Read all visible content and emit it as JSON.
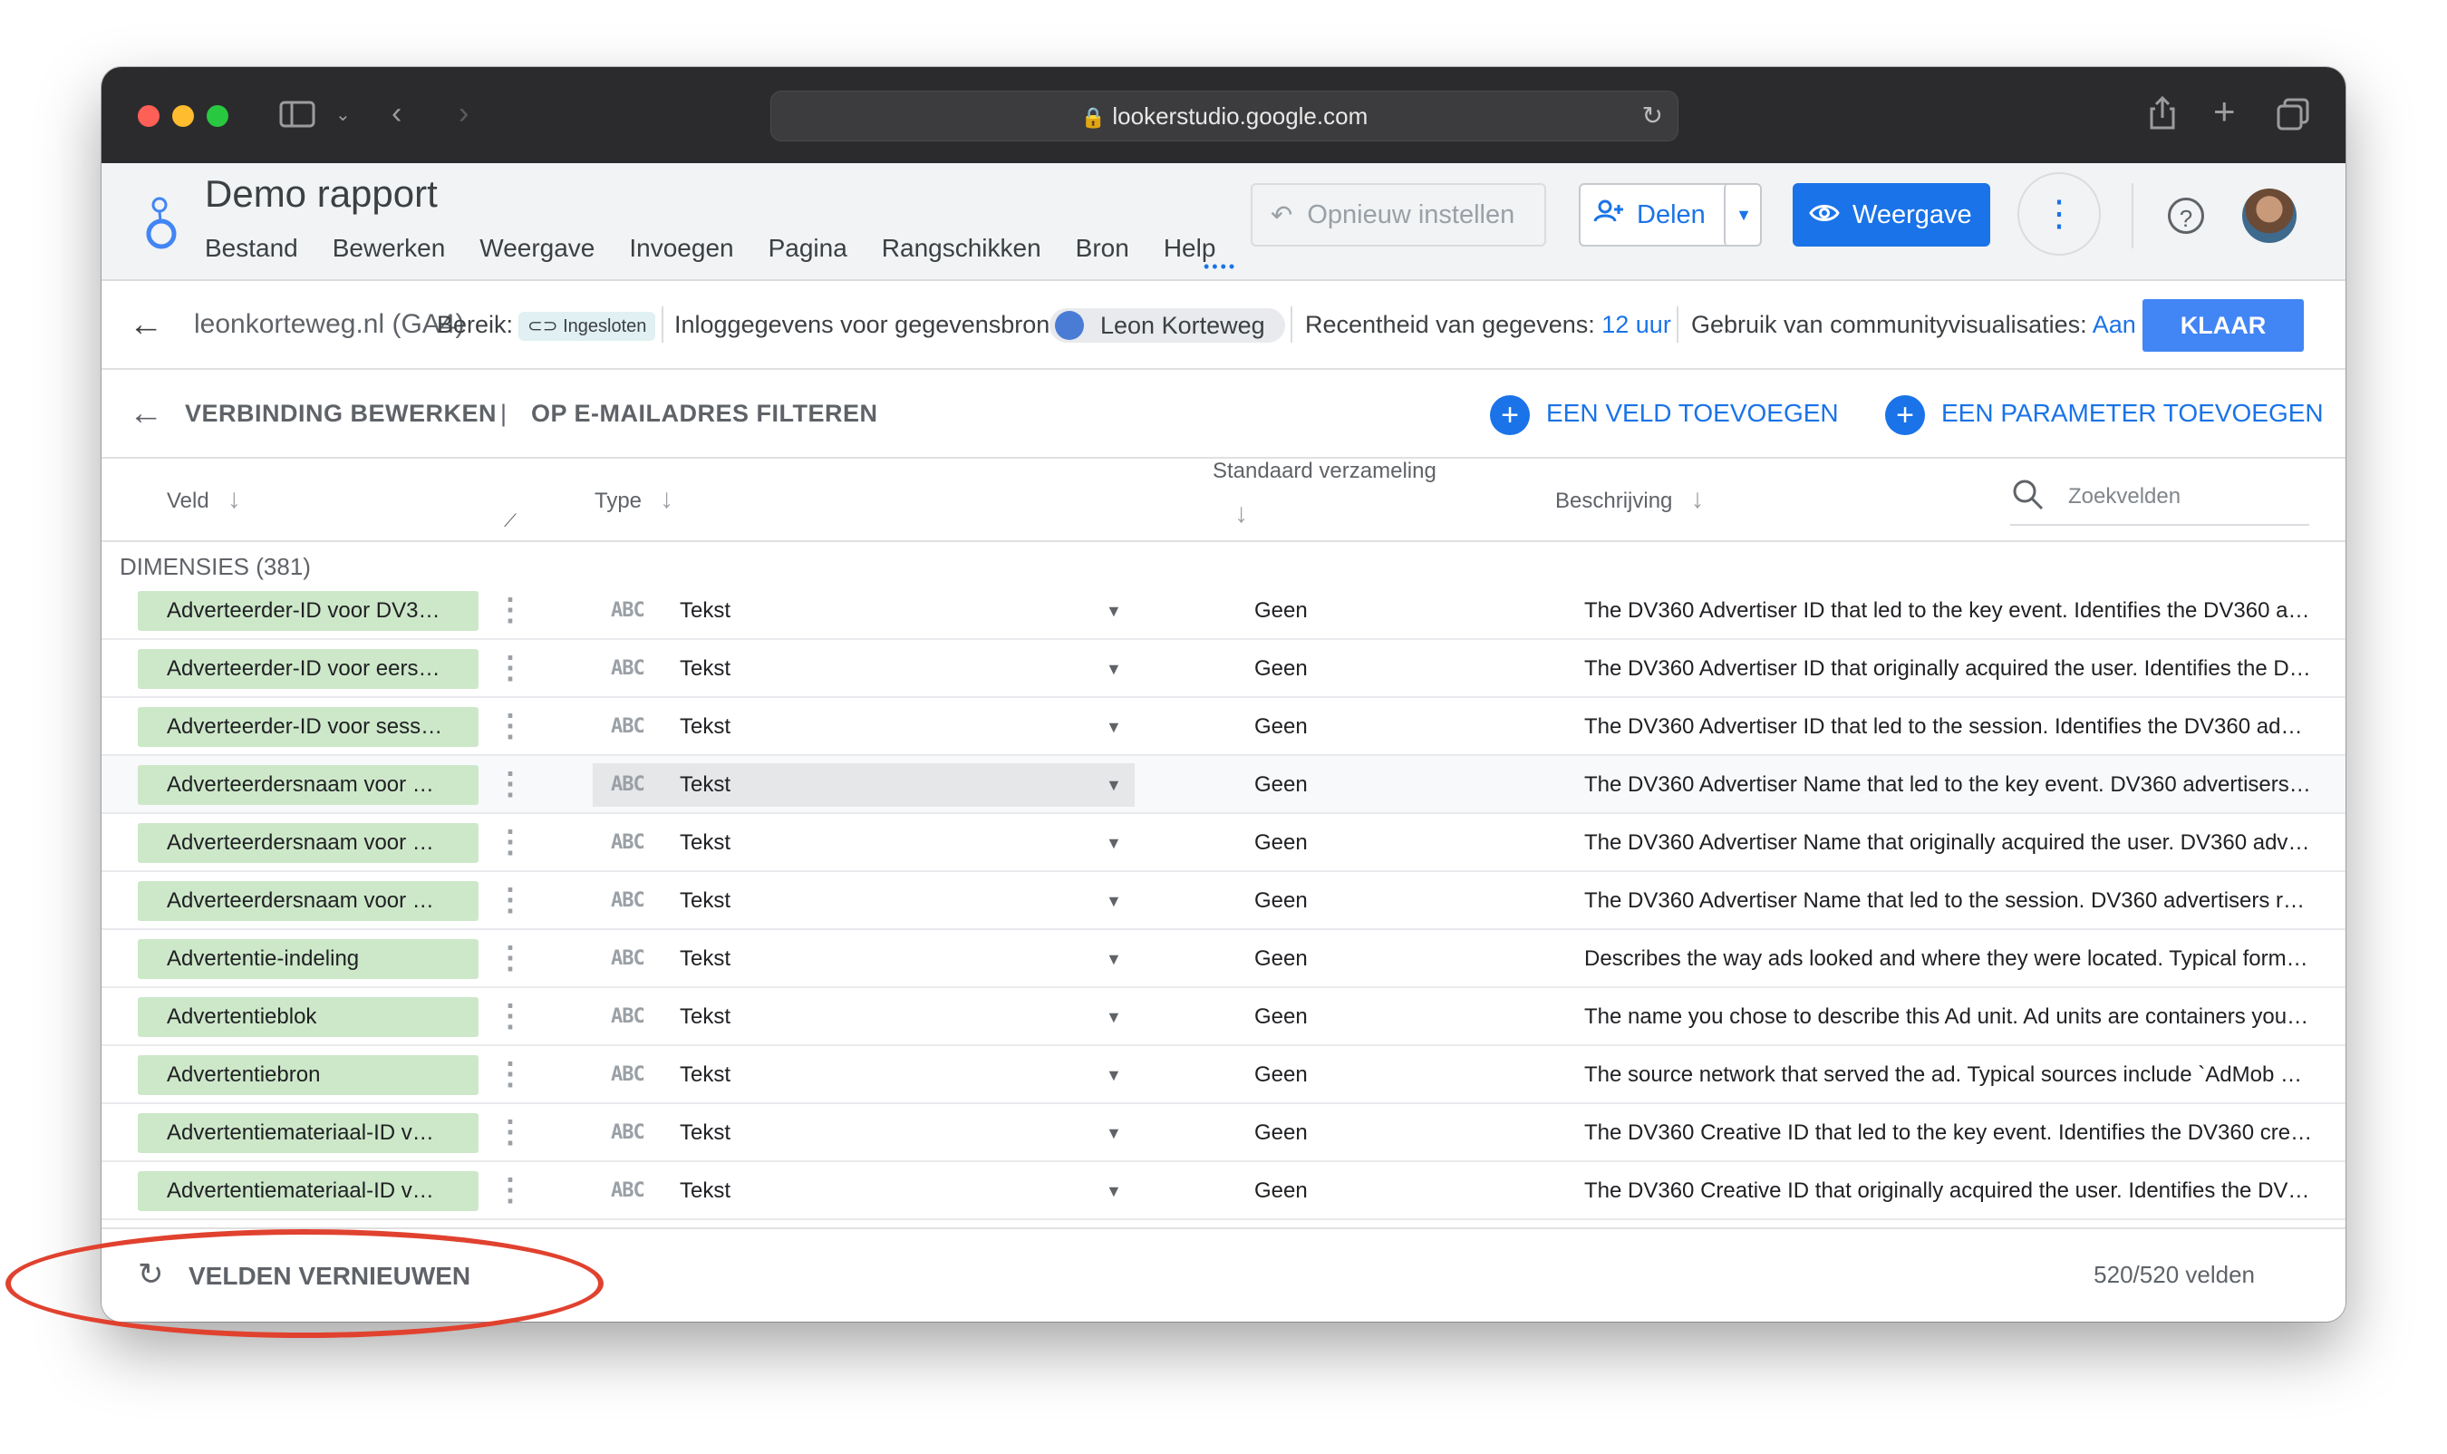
{
  "browser": {
    "url": "lookerstudio.google.com"
  },
  "header": {
    "title": "Demo rapport",
    "menu": [
      "Bestand",
      "Bewerken",
      "Weergave",
      "Invoegen",
      "Pagina",
      "Rangschikken",
      "Bron",
      "Help"
    ],
    "reset_label": "Opnieuw instellen",
    "share_label": "Delen",
    "view_label": "Weergave"
  },
  "datasource": {
    "name": "leonkorteweg.nl (GA4)",
    "scope_label": "Bereik:",
    "scope_value": "Ingesloten",
    "credentials_label": "Inloggegevens voor gegevensbron:",
    "credentials_user": "Leon Korteweg",
    "freshness_label": "Recentheid van gegevens:",
    "freshness_value": "12 uur",
    "community_label": "Gebruik van communityvisualisaties:",
    "community_value": "Aan",
    "done_label": "KLAAR"
  },
  "editor": {
    "edit_connection": "VERBINDING BEWERKEN",
    "divider": "|",
    "filter_email": "OP E-MAILADRES FILTEREN",
    "add_field": "EEN VELD TOEVOEGEN",
    "add_parameter": "EEN PARAMETER TOEVOEGEN"
  },
  "columns": {
    "field": "Veld",
    "type": "Type",
    "aggregation": "Standaard verzameling",
    "description": "Beschrijving",
    "search_placeholder": "Zoekvelden"
  },
  "section_label": "DIMENSIES (381)",
  "rows": [
    {
      "field": "Adverteerder-ID voor DV3…",
      "type_icon": "ABC",
      "type": "Tekst",
      "agg": "Geen",
      "desc": "The DV360 Advertiser ID that led to the key event. Identifies the DV360 ad…"
    },
    {
      "field": "Adverteerder-ID voor eers…",
      "type_icon": "ABC",
      "type": "Tekst",
      "agg": "Geen",
      "desc": "The DV360 Advertiser ID that originally acquired the user. Identifies the D…"
    },
    {
      "field": "Adverteerder-ID voor sess…",
      "type_icon": "ABC",
      "type": "Tekst",
      "agg": "Geen",
      "desc": "The DV360 Advertiser ID that led to the session. Identifies the DV360 adv…"
    },
    {
      "field": "Adverteerdersnaam voor …",
      "type_icon": "ABC",
      "type": "Tekst",
      "agg": "Geen",
      "desc": "The DV360 Advertiser Name that led to the key event. DV360 advertisers r…"
    },
    {
      "field": "Adverteerdersnaam voor …",
      "type_icon": "ABC",
      "type": "Tekst",
      "agg": "Geen",
      "desc": "The DV360 Advertiser Name that originally acquired the user. DV360 adve…"
    },
    {
      "field": "Adverteerdersnaam voor …",
      "type_icon": "ABC",
      "type": "Tekst",
      "agg": "Geen",
      "desc": "The DV360 Advertiser Name that led to the session. DV360 advertisers re…"
    },
    {
      "field": "Advertentie-indeling",
      "type_icon": "ABC",
      "type": "Tekst",
      "agg": "Geen",
      "desc": "Describes the way ads looked and where they were located. Typical forma…"
    },
    {
      "field": "Advertentieblok",
      "type_icon": "ABC",
      "type": "Tekst",
      "agg": "Geen",
      "desc": "The name you chose to describe this Ad unit. Ad units are containers you …"
    },
    {
      "field": "Advertentiebron",
      "type_icon": "ABC",
      "type": "Tekst",
      "agg": "Geen",
      "desc": "The source network that served the ad. Typical sources include `AdMob N…"
    },
    {
      "field": "Advertentiemateriaal-ID v…",
      "type_icon": "ABC",
      "type": "Tekst",
      "agg": "Geen",
      "desc": "The DV360 Creative ID that led to the key event. Identifies the DV360 crea…"
    },
    {
      "field": "Advertentiemateriaal-ID v…",
      "type_icon": "ABC",
      "type": "Tekst",
      "agg": "Geen",
      "desc": "The DV360 Creative ID that originally acquired the user. Identifies the DV3…"
    }
  ],
  "footer": {
    "refresh_label": "VELDEN VERNIEUWEN",
    "count": "520/520 velden"
  },
  "annotation_color": "#e0422f",
  "accent": "#1a73e8"
}
